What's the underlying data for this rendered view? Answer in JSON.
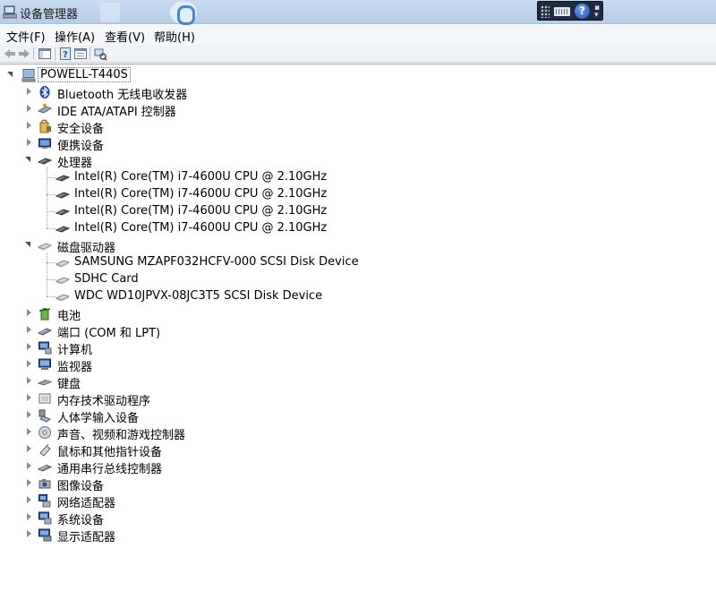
{
  "window": {
    "title": "设备管理器"
  },
  "ime": {
    "help_glyph": "?"
  },
  "menu": [
    "文件(F)",
    "操作(A)",
    "查看(V)",
    "帮助(H)"
  ],
  "root": {
    "label": "POWELL-T440S"
  },
  "tree": [
    {
      "label": "Bluetooth 无线电收发器",
      "icon": "bluetooth-icon",
      "expanded": false
    },
    {
      "label": "IDE ATA/ATAPI 控制器",
      "icon": "ide-controller-icon",
      "expanded": false
    },
    {
      "label": "安全设备",
      "icon": "security-device-icon",
      "expanded": false
    },
    {
      "label": "便携设备",
      "icon": "portable-device-icon",
      "expanded": false
    },
    {
      "label": "处理器",
      "icon": "processor-icon",
      "expanded": true,
      "children": [
        {
          "label": "Intel(R) Core(TM) i7-4600U CPU @ 2.10GHz",
          "icon": "processor-icon"
        },
        {
          "label": "Intel(R) Core(TM) i7-4600U CPU @ 2.10GHz",
          "icon": "processor-icon"
        },
        {
          "label": "Intel(R) Core(TM) i7-4600U CPU @ 2.10GHz",
          "icon": "processor-icon"
        },
        {
          "label": "Intel(R) Core(TM) i7-4600U CPU @ 2.10GHz",
          "icon": "processor-icon"
        }
      ]
    },
    {
      "label": "磁盘驱动器",
      "icon": "disk-drive-icon",
      "expanded": true,
      "children": [
        {
          "label": "SAMSUNG MZAPF032HCFV-000 SCSI Disk Device",
          "icon": "disk-drive-icon"
        },
        {
          "label": "SDHC Card",
          "icon": "disk-drive-icon"
        },
        {
          "label": "WDC WD10JPVX-08JC3T5 SCSI Disk Device",
          "icon": "disk-drive-icon"
        }
      ]
    },
    {
      "label": "电池",
      "icon": "battery-icon",
      "expanded": false
    },
    {
      "label": "端口 (COM 和 LPT)",
      "icon": "port-icon",
      "expanded": false
    },
    {
      "label": "计算机",
      "icon": "computer-icon",
      "expanded": false
    },
    {
      "label": "监视器",
      "icon": "monitor-icon",
      "expanded": false
    },
    {
      "label": "键盘",
      "icon": "keyboard-icon",
      "expanded": false
    },
    {
      "label": "内存技术驱动程序",
      "icon": "memory-technology-icon",
      "expanded": false
    },
    {
      "label": "人体学输入设备",
      "icon": "hid-icon",
      "expanded": false
    },
    {
      "label": "声音、视频和游戏控制器",
      "icon": "sound-icon",
      "expanded": false
    },
    {
      "label": "鼠标和其他指针设备",
      "icon": "mouse-icon",
      "expanded": false
    },
    {
      "label": "通用串行总线控制器",
      "icon": "usb-controller-icon",
      "expanded": false
    },
    {
      "label": "图像设备",
      "icon": "imaging-device-icon",
      "expanded": false
    },
    {
      "label": "网络适配器",
      "icon": "network-adapter-icon",
      "expanded": false
    },
    {
      "label": "系统设备",
      "icon": "system-device-icon",
      "expanded": false
    },
    {
      "label": "显示适配器",
      "icon": "display-adapter-icon",
      "expanded": false
    }
  ]
}
